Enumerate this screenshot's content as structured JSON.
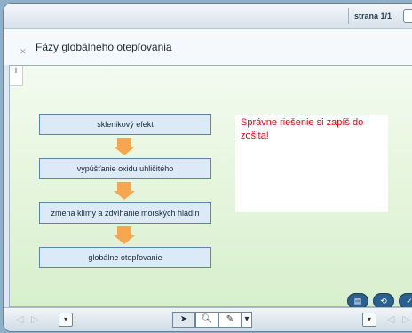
{
  "header": {
    "page_indicator": "strana 1/1"
  },
  "title": "Fázy globálneho otepľovania",
  "info_label": "i",
  "flow": [
    {
      "label": "sklenikový efekt"
    },
    {
      "label": "vypúšťanie oxidu uhličitého"
    },
    {
      "label": "zmena klímy a zdvíhanie morských hladín"
    },
    {
      "label": "globálne otepľovanie"
    }
  ],
  "note": "Správne riešenie si zapíš do zošita!",
  "icons": {
    "close": "close-icon",
    "prev": "arrow-left-icon",
    "next": "arrow-right-icon",
    "pointer": "pointer-icon",
    "zoom": "magnifier-icon",
    "pen": "pen-icon"
  },
  "colors": {
    "arrow": "#f5a64f",
    "note_text": "#e30613",
    "box_fill": "#dce9f7"
  }
}
